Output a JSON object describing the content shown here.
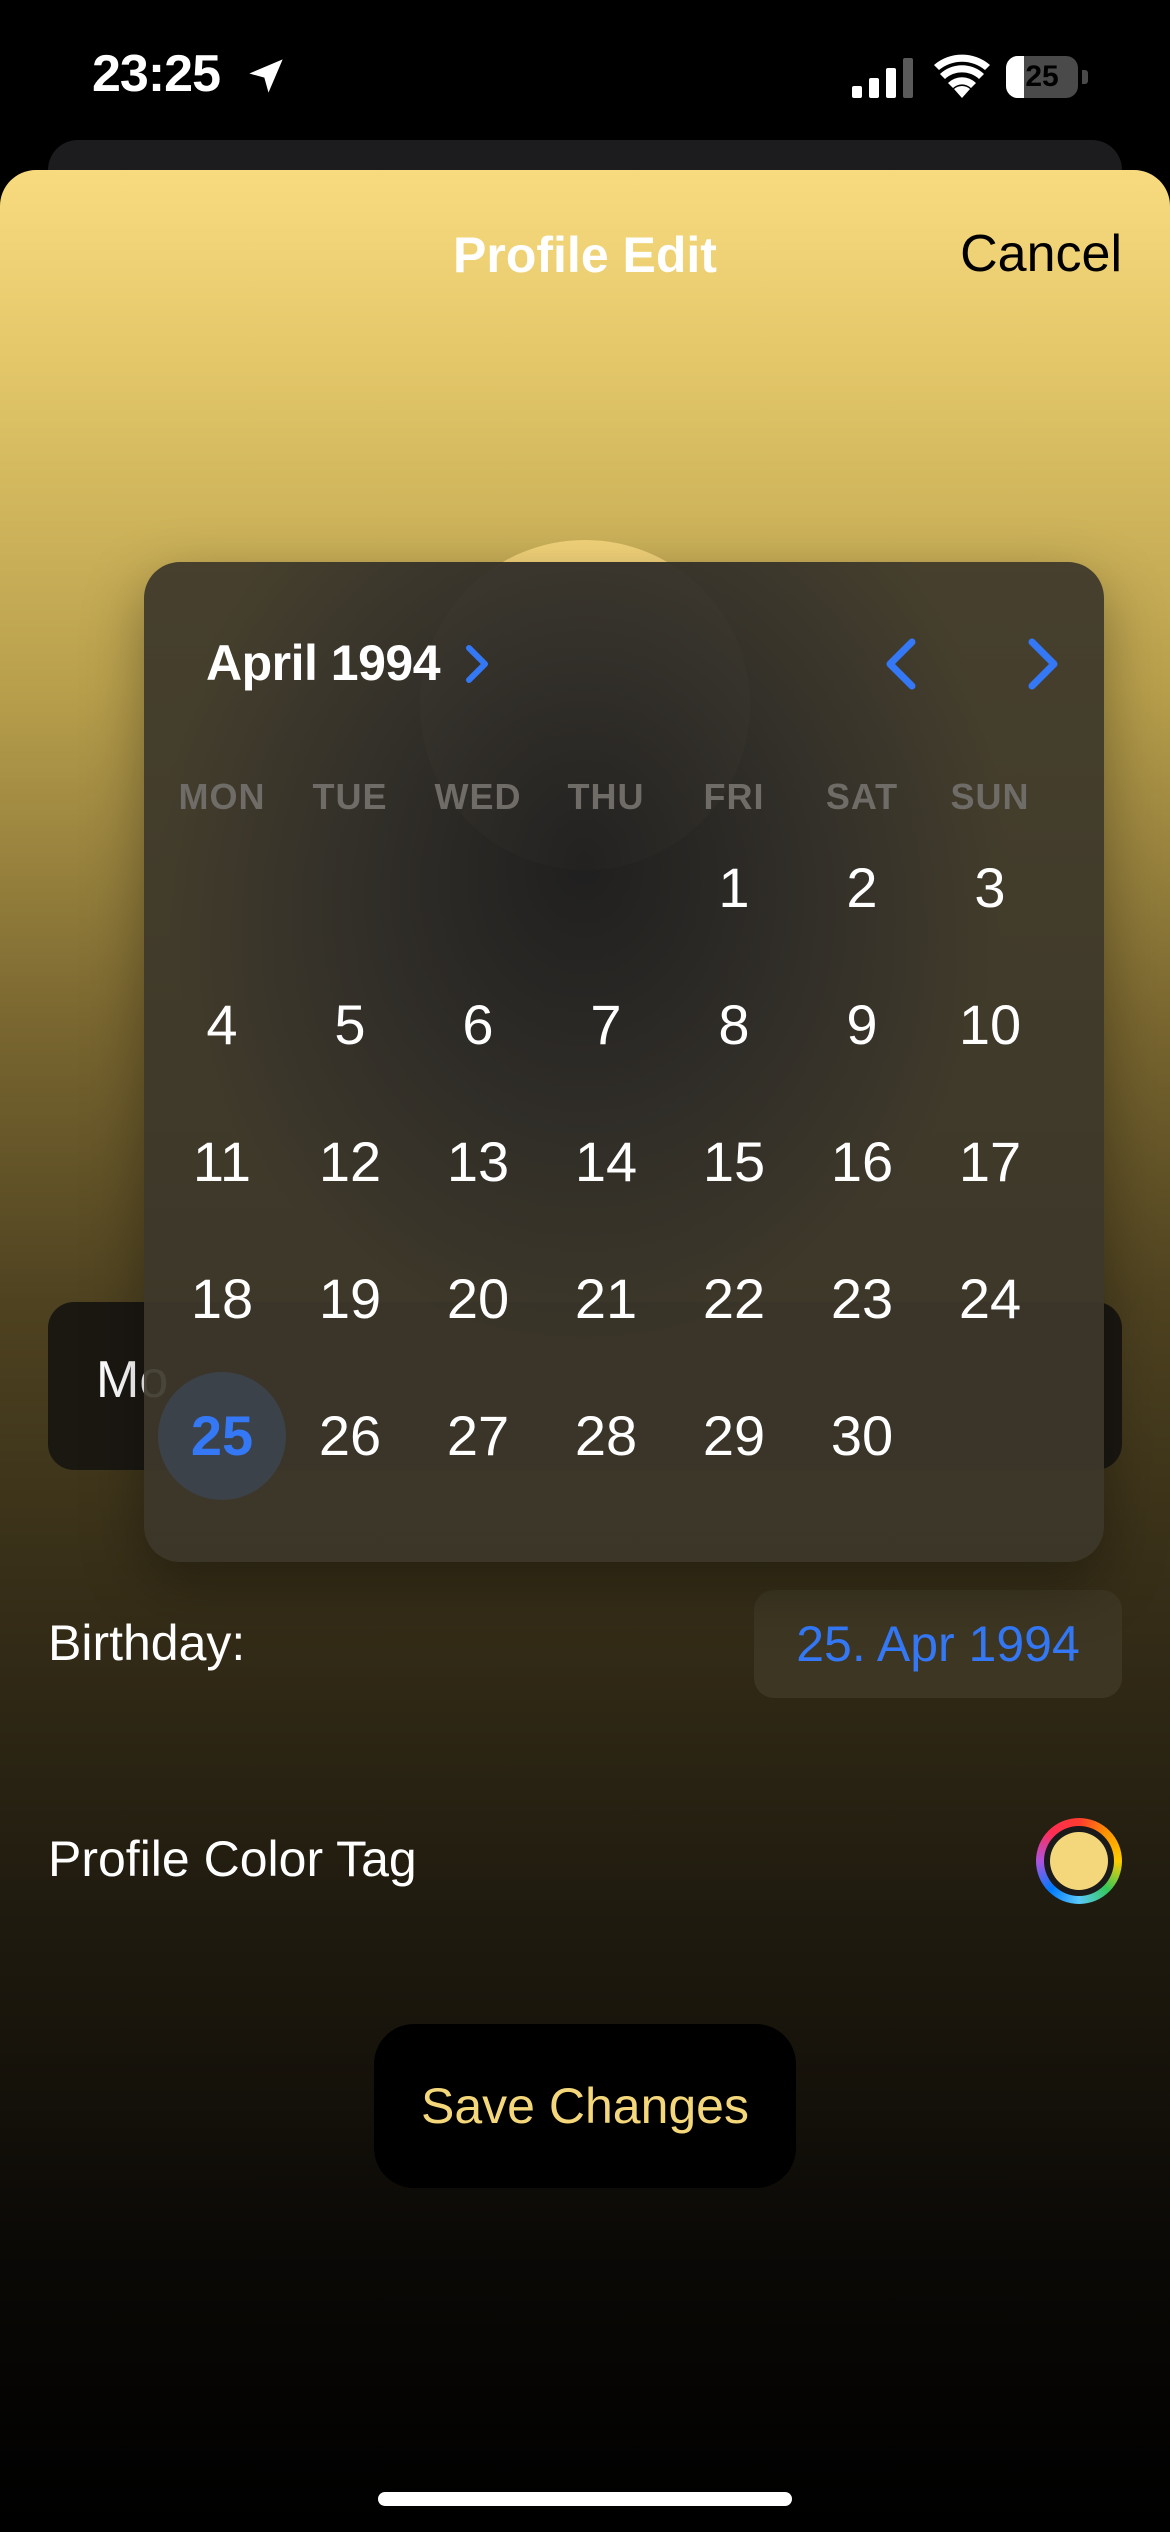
{
  "status_bar": {
    "time": "23:25",
    "battery": "25",
    "battery_level": 0.25
  },
  "nav": {
    "title": "Profile Edit",
    "cancel": "Cancel"
  },
  "name_field": {
    "value": "Mo"
  },
  "birthday": {
    "label": "Birthday:",
    "value": "25. Apr 1994"
  },
  "color_tag": {
    "label": "Profile Color Tag",
    "swatch_color": "#f4d77a"
  },
  "save_button": {
    "label": "Save Changes"
  },
  "calendar": {
    "month_label": "April 1994",
    "weekdays": [
      "MON",
      "TUE",
      "WED",
      "THU",
      "FRI",
      "SAT",
      "SUN"
    ],
    "first_weekday_index": 4,
    "days_in_month": 30,
    "selected_day": 25
  },
  "colors": {
    "accent_blue": "#3478f6",
    "accent_gold": "#f4d77a"
  },
  "icons": [
    "location-arrow-icon",
    "signal-icon",
    "wifi-icon",
    "battery-icon",
    "chevron-right-icon",
    "chevron-left-icon"
  ]
}
